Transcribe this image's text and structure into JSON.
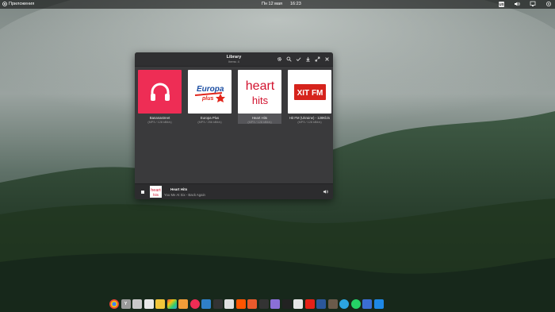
{
  "top_panel": {
    "apps_label": "Приложения",
    "date": "Пн 12 мая",
    "time": "16:23",
    "keyboard_layout": "US"
  },
  "window": {
    "title": "Library",
    "subtitle": "Items: 4",
    "stations": [
      {
        "name": "Bananastreet",
        "format": "(MP3 / 128 kBit/s)",
        "art_color": "#ee2d55"
      },
      {
        "name": "Europa Plus",
        "format": "(MP3 / 256 kBit/s)",
        "art_color": "#ffffff",
        "logo_line1": "Europa",
        "logo_line2": "plus"
      },
      {
        "name": "Heart Hits",
        "format": "(MP3 / 128 kBit/s)",
        "art_color": "#ffffff",
        "logo_line1": "heart",
        "logo_line2": "hits"
      },
      {
        "name": "Hit FM (Ukraine) - 128Kb/s",
        "format": "(MP3 / 128 kBit/s)",
        "art_color": "#ffffff",
        "logo_line1": "ХIТ FM"
      }
    ],
    "player": {
      "station": "Heart Hits",
      "track": "You Me At Six - Back Again",
      "art_line1": "heart",
      "art_line2": "hits"
    }
  },
  "dock_apps": [
    "chrome",
    "tweaks",
    "files",
    "mail",
    "notes",
    "photos",
    "music",
    "headphones",
    "settings",
    "terminal-dark",
    "soundcloud",
    "radio",
    "cast",
    "cube",
    "terminal",
    "calculator",
    "youtube",
    "word",
    "monitor",
    "gimp",
    "telegram",
    "whatsapp",
    "vpn",
    "cloud"
  ]
}
